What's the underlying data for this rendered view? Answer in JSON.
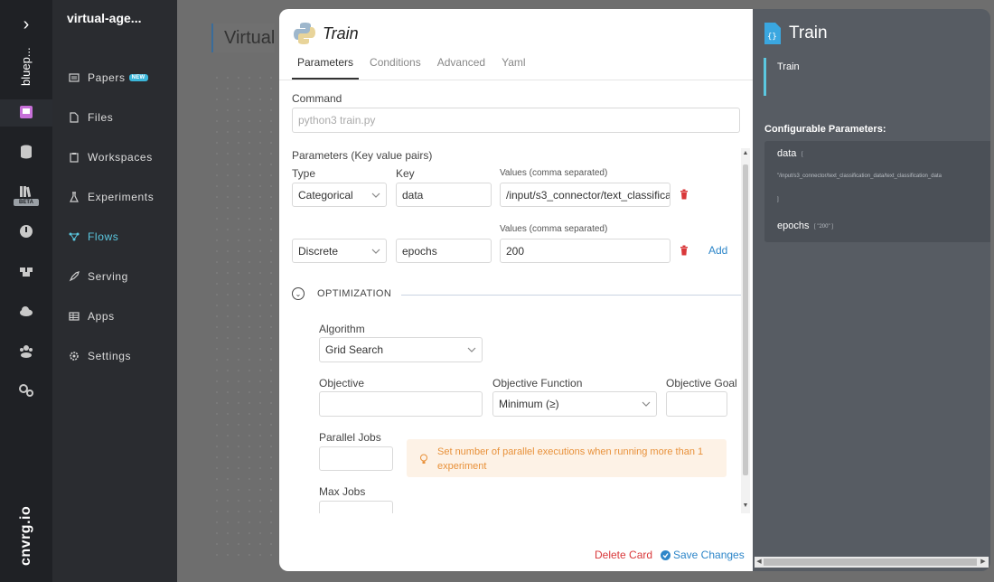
{
  "sidebar": {
    "project_name": "bluep...",
    "brand": "cnvrg.io",
    "beta_label": "BETA"
  },
  "nav": {
    "title": "virtual-age...",
    "items": [
      {
        "label": "Papers",
        "icon": "papers-icon",
        "badge": "NEW"
      },
      {
        "label": "Files",
        "icon": "file-icon"
      },
      {
        "label": "Workspaces",
        "icon": "workspace-icon"
      },
      {
        "label": "Experiments",
        "icon": "flask-icon"
      },
      {
        "label": "Flows",
        "icon": "flows-icon",
        "active": true
      },
      {
        "label": "Serving",
        "icon": "rocket-icon"
      },
      {
        "label": "Apps",
        "icon": "table-icon"
      },
      {
        "label": "Settings",
        "icon": "gear-icon"
      }
    ]
  },
  "background": {
    "title": "Virtual"
  },
  "modal": {
    "title": "Train",
    "tabs": [
      "Parameters",
      "Conditions",
      "Advanced",
      "Yaml"
    ],
    "command_label": "Command",
    "command_placeholder": "python3 train.py",
    "params_label": "Parameters (Key value pairs)",
    "type_label": "Type",
    "key_label": "Key",
    "values_label": "Values (comma separated)",
    "params": [
      {
        "type": "Categorical",
        "key": "data",
        "values": "/input/s3_connector/text_classifica"
      },
      {
        "type": "Discrete",
        "key": "epochs",
        "values": "200"
      }
    ],
    "add_label": "Add",
    "optimization_label": "OPTIMIZATION",
    "algorithm_label": "Algorithm",
    "algorithm_value": "Grid Search",
    "objective_label": "Objective",
    "objective_value": "",
    "objective_function_label": "Objective Function",
    "objective_function_value": "Minimum (≥)",
    "objective_goal_label": "Objective Goal",
    "objective_goal_value": "",
    "parallel_jobs_label": "Parallel Jobs",
    "parallel_jobs_value": "",
    "hint": "Set number of parallel executions when running more than 1 experiment",
    "max_jobs_label": "Max Jobs",
    "delete_label": "Delete Card",
    "save_label": "Save Changes"
  },
  "right_panel": {
    "title": "Train",
    "node_label": "Train",
    "config_label": "Configurable Parameters:",
    "params": [
      {
        "key": "data",
        "open": "[",
        "value": "\"/input/s3_connector/text_classification_data/text_classification_data",
        "close": "]"
      },
      {
        "key": "epochs",
        "value": "[ \"200\" ]"
      }
    ]
  },
  "colors": {
    "accent": "#2d86c9",
    "active_nav": "#5bc8e0",
    "danger": "#d9383a",
    "hint_text": "#e8913a"
  }
}
